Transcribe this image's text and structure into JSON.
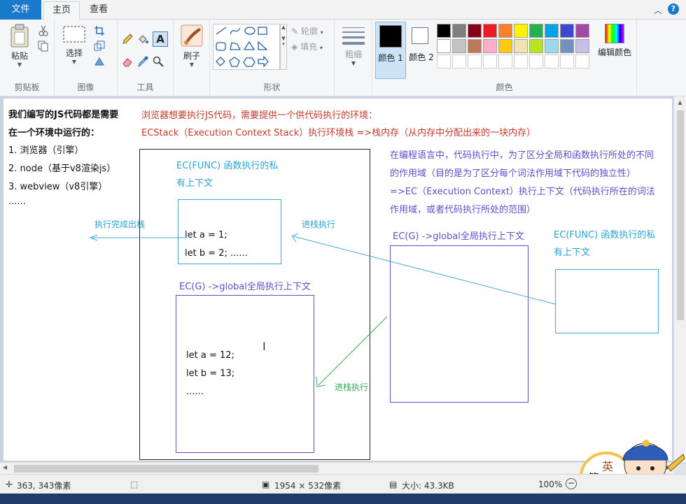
{
  "tabs": {
    "file": "文件",
    "home": "主页",
    "view": "查看"
  },
  "ribbon": {
    "clipboard": {
      "paste": "粘贴",
      "label": "剪贴板"
    },
    "image": {
      "select": "选择",
      "label": "图像"
    },
    "tools": {
      "label": "工具"
    },
    "brush": {
      "label": "刷子"
    },
    "shapes": {
      "outline": "轮廓",
      "fill": "填充",
      "label": "形状"
    },
    "size": {
      "label": "粗细"
    },
    "color1": "颜色 1",
    "color2": "颜色 2",
    "colors": {
      "label": "颜色",
      "edit": "编辑颜色"
    }
  },
  "palette": {
    "row1": [
      "#000000",
      "#7f7f7f",
      "#880015",
      "#ed1c24",
      "#ff7f27",
      "#fff200",
      "#22b14c",
      "#00a2e8",
      "#3f48cc",
      "#a349a4"
    ],
    "row2": [
      "#ffffff",
      "#c3c3c3",
      "#b97a57",
      "#ffaec9",
      "#ffc90e",
      "#efe4b0",
      "#b5e61d",
      "#99d9ea",
      "#7092be",
      "#c8bfe7"
    ]
  },
  "canvas": {
    "left_notes": {
      "heading1": "我们编写的JS代码都是需要",
      "heading2": "在一个环境中运行的：",
      "item1": "1. 浏览器（引擎）",
      "item2": "2. node（基于v8渲染js）",
      "item3": "3. webview（v8引擎）",
      "more": "......"
    },
    "red_line1": "浏览器想要执行JS代码，需要提供一个供代码执行的环境：",
    "red_line2": "ECStack（Execution Context Stack）执行环境栈 =>栈内存（从内存中分配出来的一块内存）",
    "purple_para": {
      "l1": "在编程语言中，代码执行中，为了区分全局和函数执行所处的不同",
      "l2": "的作用域（目的是为了区分每个词法作用域下代码的独立性）",
      "l3": "=>EC（Execution Context）执行上下文（代码执行所在的词法",
      "l4": "作用域，或者代码执行所处的范围）"
    },
    "stack_func_label1": "EC(FUNC) 函数执行的私",
    "stack_func_label2": "有上下文",
    "func_code1": "let a = 1;",
    "func_code2": "let b = 2;   ......",
    "stack_global_label": "EC(G)  ->global全局执行上下文",
    "global_code1": "let a = 12;",
    "global_code2": "let b = 13;",
    "global_code3": "......",
    "pop_label": "执行完成出栈",
    "push_label_top": "进栈执行",
    "push_label_bottom": "进栈执行",
    "right_global_label": "EC(G)  ->global全局执行上下文",
    "right_func_label1": "EC(FUNC) 函数执行的私",
    "right_func_label2": "有上下文",
    "avatar_badge1": "英",
    "avatar_badge2": "简"
  },
  "status": {
    "cursor": "363, 343像素",
    "dimensions": "1954 × 532像素",
    "size": "大小: 43.3KB",
    "zoom": "100%"
  }
}
